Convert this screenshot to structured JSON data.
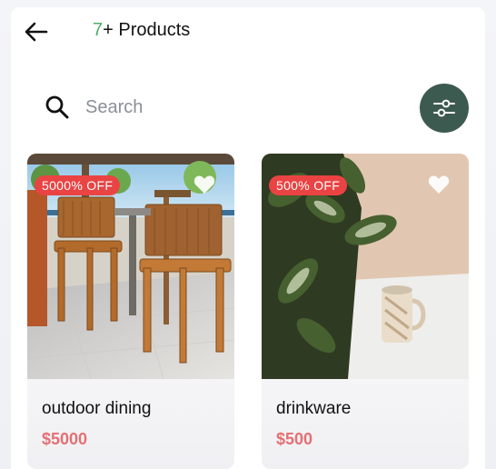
{
  "header": {
    "back_icon": "arrow-left-icon",
    "count": "7",
    "title_suffix": "+ Products"
  },
  "search": {
    "icon": "search-icon",
    "placeholder": "Search",
    "value": ""
  },
  "filter": {
    "icon": "sliders-icon",
    "color": "#3d5a50"
  },
  "products": [
    {
      "name": "outdoor dining",
      "price": "$5000",
      "discount": "5000% OFF",
      "favorite_icon": "heart-icon"
    },
    {
      "name": "drinkware",
      "price": "$500",
      "discount": "500% OFF",
      "favorite_icon": "heart-icon"
    }
  ],
  "colors": {
    "accent_green": "#4caf6a",
    "discount_red": "#ea4343",
    "price_red": "#e46f73"
  }
}
